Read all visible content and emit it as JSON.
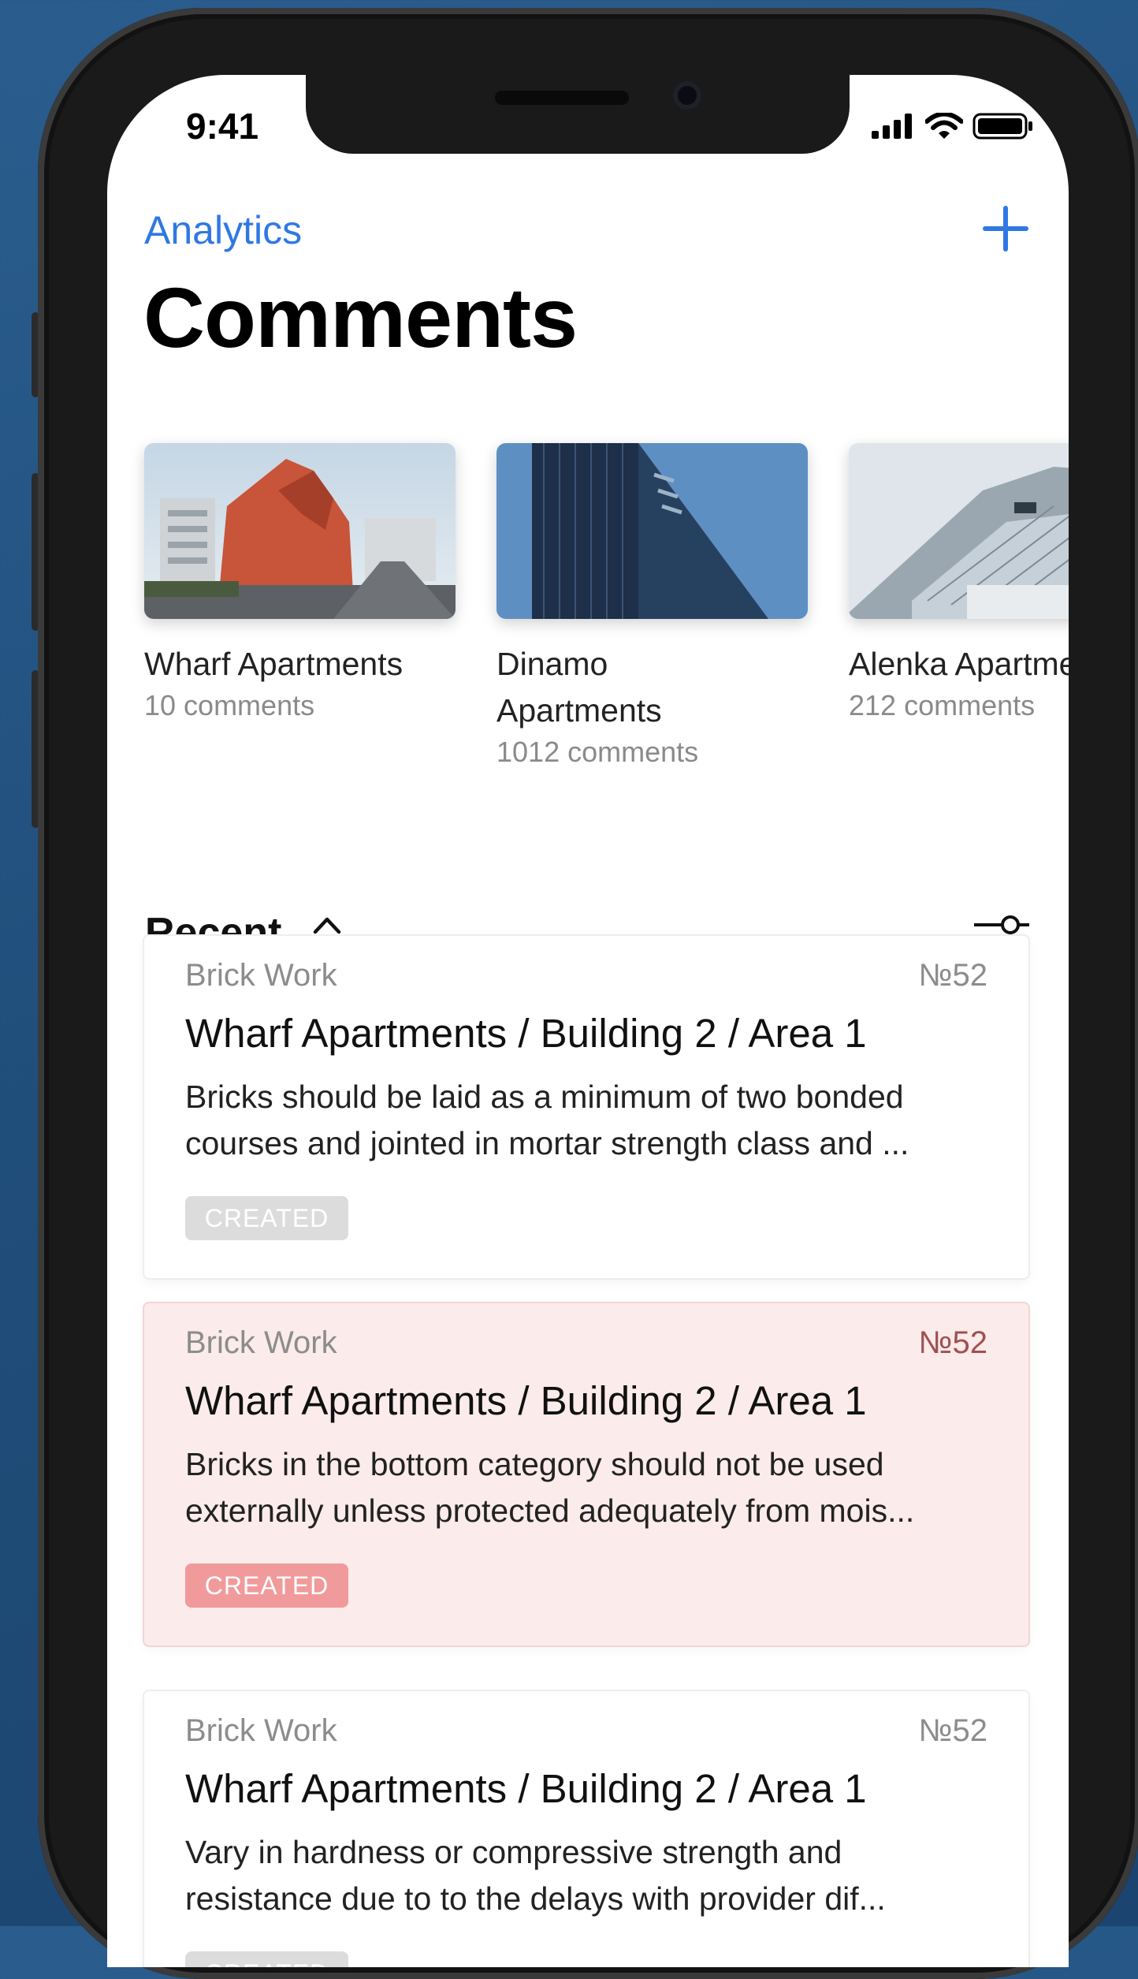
{
  "status_bar": {
    "time": "9:41"
  },
  "nav": {
    "back_label": "Analytics",
    "add_icon": "plus-icon"
  },
  "page": {
    "title": "Comments"
  },
  "projects": [
    {
      "name": "Wharf Apartments",
      "count": "10 comments"
    },
    {
      "name": "Dinamo Apartments",
      "count": "1012 comments"
    },
    {
      "name": "Alenka Apartments",
      "count": "212 comments"
    }
  ],
  "list_header": {
    "label": "Recent",
    "sort_icon": "sort-chevrons-icon",
    "filter_icon": "filter-sliders-icon"
  },
  "comments": [
    {
      "category": "Brick Work",
      "number": "№52",
      "path": "Wharf Apartments / Building 2 / Area 1",
      "text": "Bricks should be laid as a minimum of two bonded courses and jointed in mortar strength class and ...",
      "status": "CREATED"
    },
    {
      "category": "Brick Work",
      "number": "№52",
      "path": "Wharf Apartments / Building 2 / Area 1",
      "text": "Bricks in the bottom category should not be used externally unless protected adequately from mois...",
      "status": "CREATED"
    },
    {
      "category": "Brick Work",
      "number": "№52",
      "path": "Wharf Apartments / Building 2 / Area 1",
      "text": "Vary in hardness or compressive strength and resistance due to to the delays with provider dif...",
      "status": "CREATED"
    }
  ],
  "colors": {
    "accent": "#2f78e4",
    "alert_bg": "#fcebeb",
    "alert_badge": "#f19a9c",
    "badge": "#dcdcdc"
  }
}
